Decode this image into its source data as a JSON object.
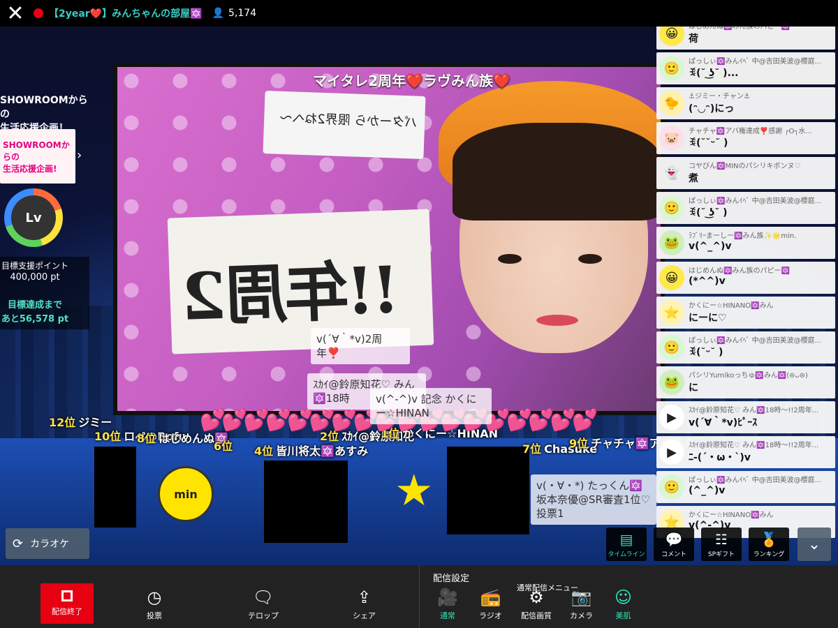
{
  "topbar": {
    "close": "✕",
    "room_title": "【2year❤️】みんちゃんの部屋🔯",
    "viewer_icon": "person-icon",
    "viewer_count": "5,174"
  },
  "video": {
    "caption": "マイタレ2周年❤️ラヴみん族❤️",
    "sign_text": "!!年周2",
    "board_text": "パターから 限界2ねへ〜"
  },
  "left_panel": {
    "banner_title": "SHOWROOMからの\n生活応援企画！vol.3",
    "banner_image_text": "SHOWROOMからの\n生活応援企画!",
    "level": "Lv",
    "support_label": "目標支援ポイント",
    "support_value": "400,000 pt",
    "goal_label": "目標達成まで",
    "goal_value": "あと56,578 pt"
  },
  "ranking": [
    {
      "pos": "12位",
      "name": "ジミー"
    },
    {
      "pos": "10位",
      "name": "ロペ@Bofu"
    },
    {
      "pos": "8位",
      "name": "はじめんぬ🔯"
    },
    {
      "pos": "6位",
      "name": ""
    },
    {
      "pos": "4位",
      "name": "皆川将太🔯あすみ"
    },
    {
      "pos": "2位",
      "name": "ｽｶｲ@鈴原知花"
    },
    {
      "pos": "1位",
      "name": "かくにー☆HINAN"
    },
    {
      "pos": "7位",
      "name": "Chasuke"
    },
    {
      "pos": "9位",
      "name": "チャチャ🔯アバ権達"
    }
  ],
  "popups": [
    {
      "text": "v(´∀｀*v)2周年❣️"
    },
    {
      "text": "ｽｶｲ@鈴原知花♡ みん🔯18時"
    },
    {
      "text": "v(^-^)v 記念 かくにー☆HINAN"
    },
    {
      "text": "v(・∀・*) たっくん🔯坂本奈優@SR審査1位♡投票1"
    }
  ],
  "karaoke": {
    "label": "カラオケ"
  },
  "comments": [
    {
      "name": "",
      "text": "ꉂ(˘ᵕ˘ )",
      "avatar": "🙂",
      "bg": "#dff5d5"
    },
    {
      "name": "はじめんぬ🔯みん族のパピー🔯",
      "text": "荷",
      "avatar": "😀",
      "bg": "#ffe94a"
    },
    {
      "name": "ぱっしぃ🔯みんｲﾍﾞ 中@吉田美波@櫻庭...",
      "text": "ꉂ(˘ ͜ʖ˘ )...",
      "avatar": "🙂",
      "bg": "#d9f7d0"
    },
    {
      "name": "⚓ジミー・チャン⚓",
      "text": "(ᵔ◡ᵔ)にっ",
      "avatar": "🐤",
      "bg": "#fff1a8"
    },
    {
      "name": "チャチャ🔯アバ権達成❣️感謝 ┌O┐水...",
      "text": "ꉂ(˘˘ᵕ˘ )",
      "avatar": "🐷",
      "bg": "#fbe0ec"
    },
    {
      "name": "コヤびん🔯MINのパシリキボンヌ♡",
      "text": "煮",
      "avatar": "👻",
      "bg": "#eee"
    },
    {
      "name": "ぱっしぃ🔯みんｲﾍﾞ 中@吉田美波@櫻庭...",
      "text": "ꉂ(˘ ͜ʖ˘ )",
      "avatar": "🙂",
      "bg": "#d9f7d0"
    },
    {
      "name": "ﾗﾌﾞﾘｰまーしー🔯みん族✨🌟min.",
      "text": "v(^_^)v",
      "avatar": "🐸",
      "bg": "#cfeebd"
    },
    {
      "name": "はじめんぬ🔯みん族のパピー🔯",
      "text": "(*^^)v",
      "avatar": "😀",
      "bg": "#ffe94a"
    },
    {
      "name": "かくにー☆HINANO🔯みん",
      "text": "にーに♡",
      "avatar": "⭐",
      "bg": "#fff3b0"
    },
    {
      "name": "ぱっしぃ🔯みんｲﾍﾞ 中@吉田美波@櫻庭...",
      "text": "ꉂ(˘ᵕ˘ )",
      "avatar": "🙂",
      "bg": "#d9f7d0"
    },
    {
      "name": "パシリYumikoっちゅ🔯みん🔯(⊜ᴗ⊜)",
      "text": "に",
      "avatar": "🐸",
      "bg": "#cfeebd"
    },
    {
      "name": "ｽｶｲ@鈴原知花♡ みん🔯18時〜!!2周年...",
      "text": "v(´∀｀*v)ﾋﾟｰｽ",
      "avatar": "▶",
      "bg": "#fff"
    },
    {
      "name": "ｽｶｲ@鈴原知花♡ みん🔯18時〜!!2周年...",
      "text": "ﾆ-(´・ω・`)v",
      "avatar": "▶",
      "bg": "#fff"
    },
    {
      "name": "ぱっしぃ🔯みんｲﾍﾞ 中@吉田美波@櫻庭...",
      "text": "(^_^)v",
      "avatar": "🙂",
      "bg": "#d9f7d0"
    },
    {
      "name": "かくにー☆HINANO🔯みん",
      "text": "v(^-^)v",
      "avatar": "⭐",
      "bg": "#fff3b0"
    }
  ],
  "right_buttons": [
    {
      "label": "タイムライン",
      "icon": "timeline-icon",
      "glyph": "▤"
    },
    {
      "label": "コメント",
      "icon": "comment-icon",
      "glyph": "💬"
    },
    {
      "label": "SPギフト",
      "icon": "sp-gift-icon",
      "glyph": "☷"
    },
    {
      "label": "ランキング",
      "icon": "ranking-icon",
      "glyph": "🏅"
    }
  ],
  "collapse": "⌄",
  "bottombar": {
    "end_label": "配信終了",
    "vote_label": "投票",
    "telop_label": "テロップ",
    "share_label": "シェア",
    "settings_title": "配信設定",
    "normal_menu_label": "通常配信メニュー",
    "normal_label": "通常",
    "radio_label": "ラジオ",
    "quality_label": "配信画質",
    "camera_label": "カメラ",
    "beauty_label": "美肌"
  },
  "colors": {
    "accent": "#2ee6b8",
    "live_red": "#e60012",
    "title_teal": "#37d0c6",
    "rank_yellow": "#ffe24a"
  }
}
